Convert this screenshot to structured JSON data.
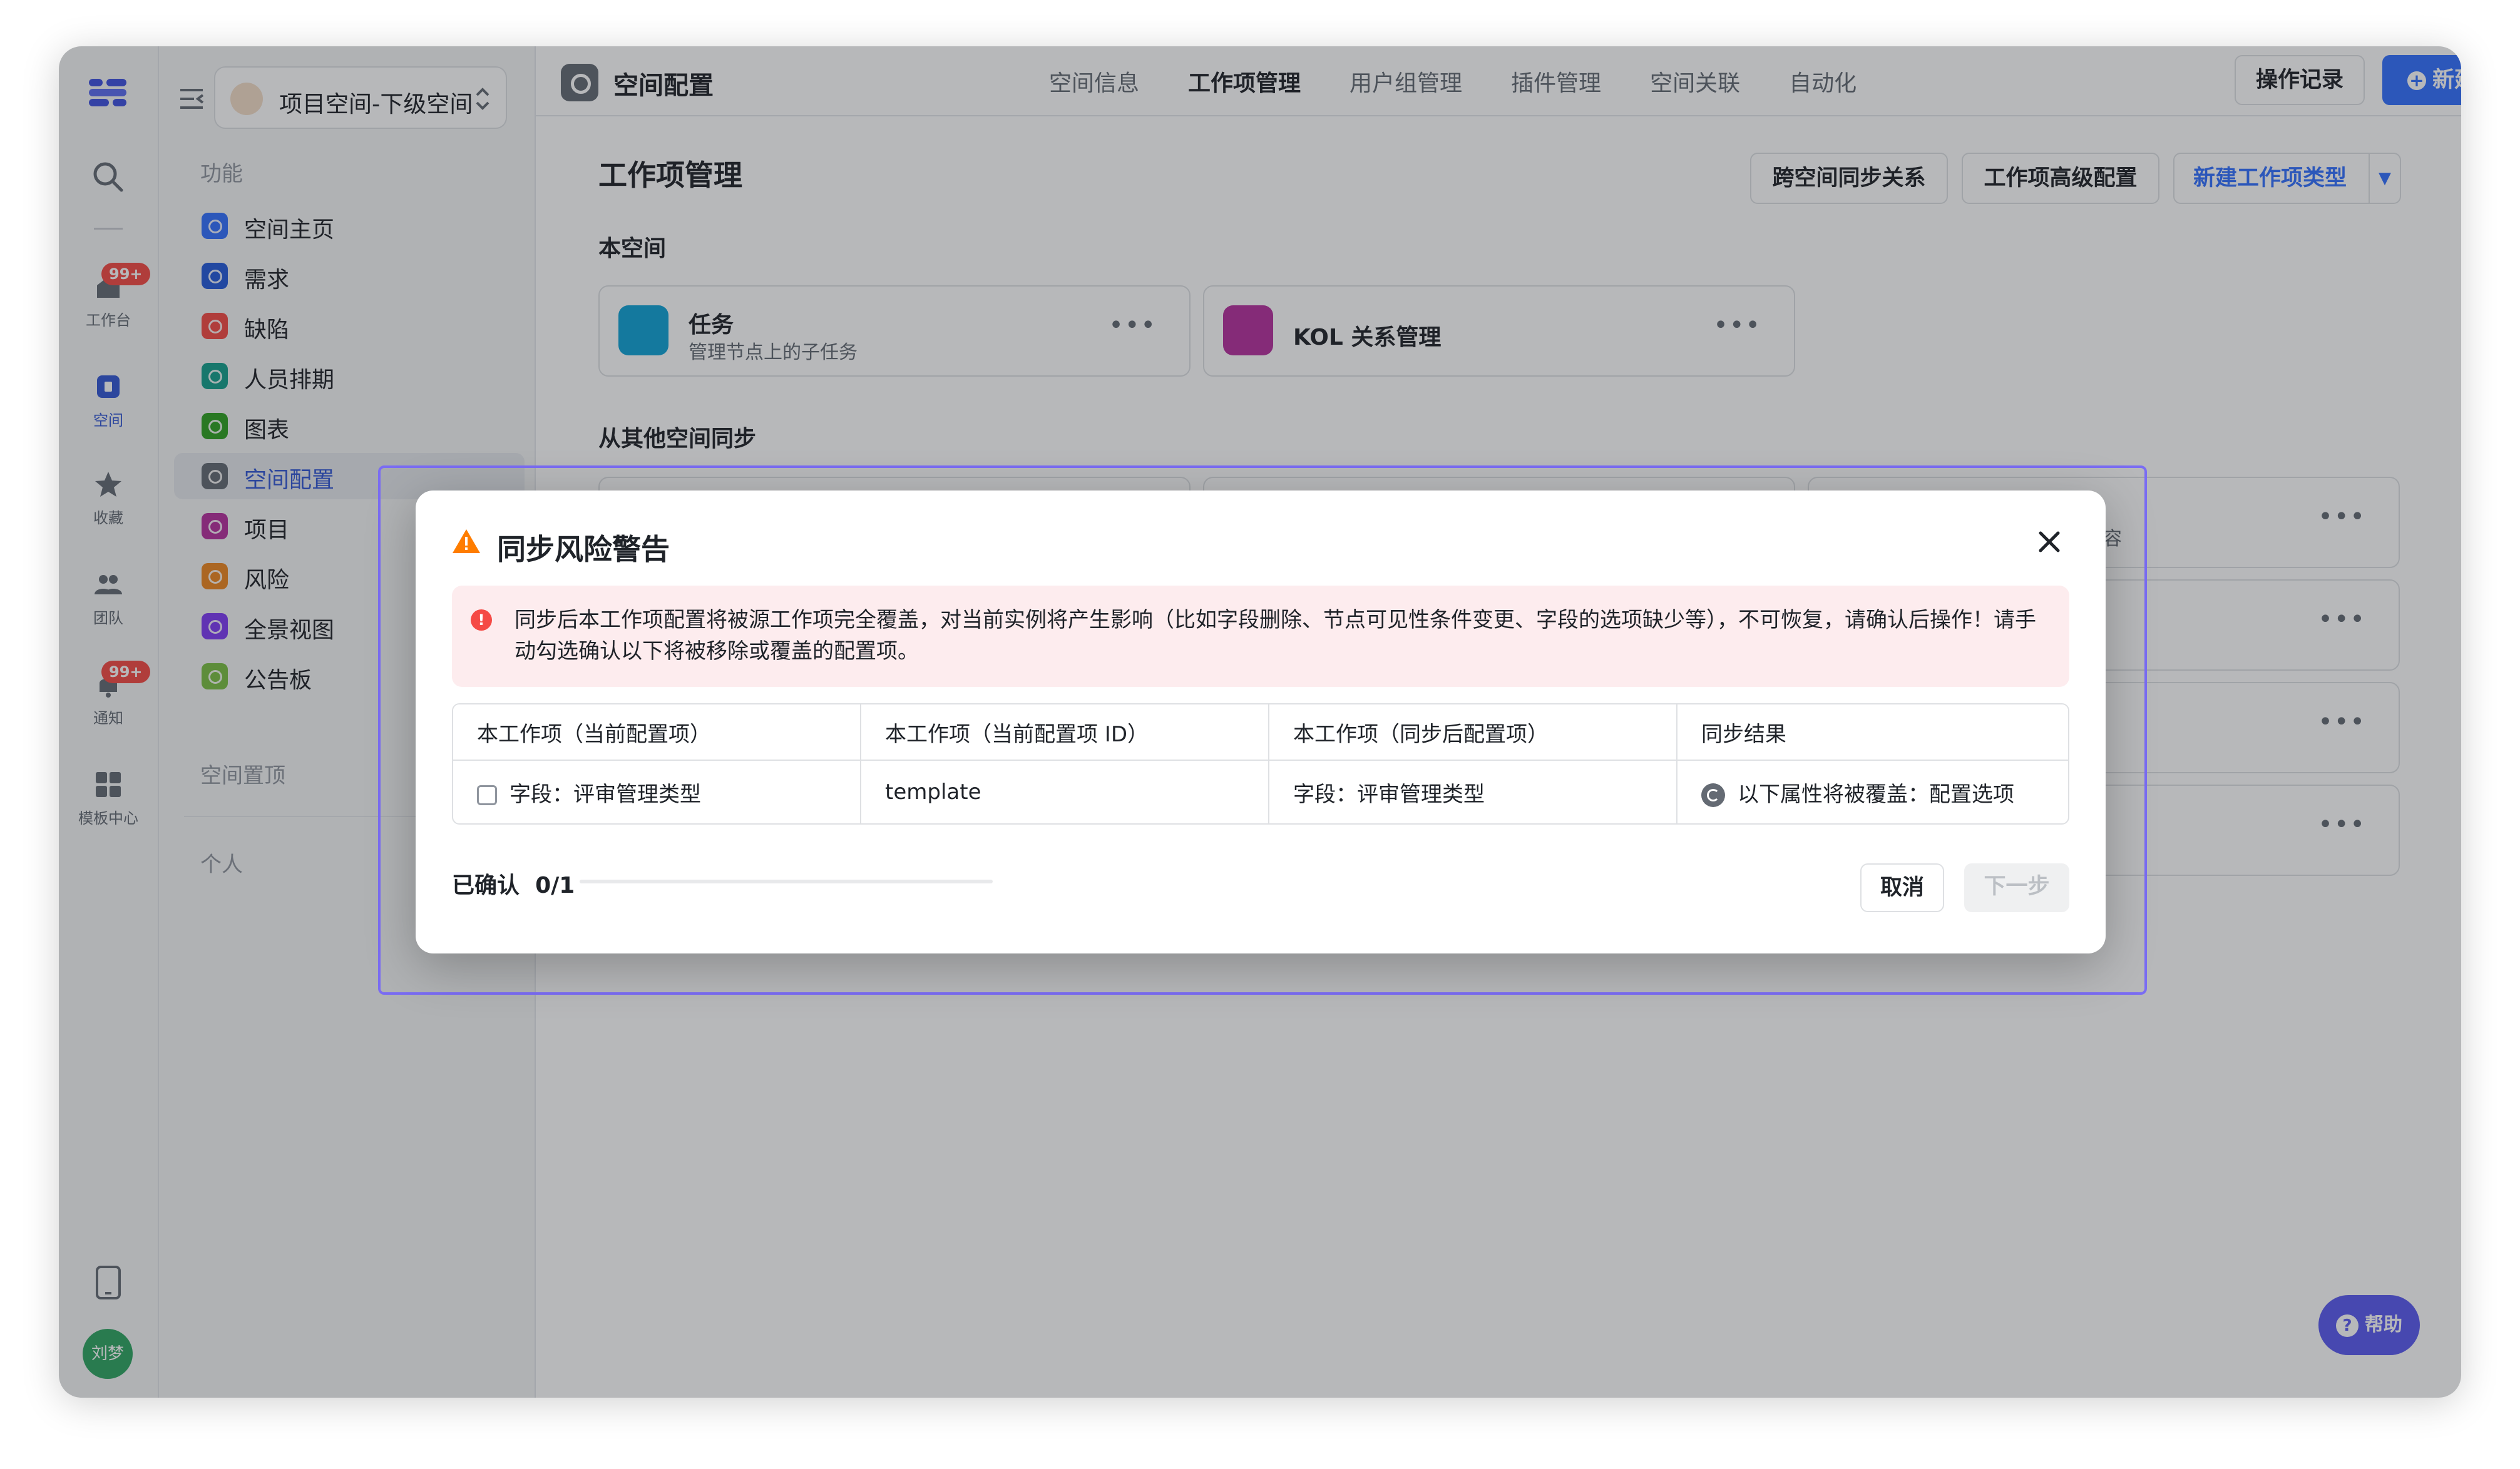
{
  "rail": {
    "items": [
      {
        "label": "工作台",
        "badge": "99+"
      },
      {
        "label": "空间"
      },
      {
        "label": "收藏"
      },
      {
        "label": "团队"
      },
      {
        "label": "通知",
        "badge": "99+"
      },
      {
        "label": "模板中心"
      }
    ],
    "avatar": "刘梦"
  },
  "sidebar": {
    "space_name": "项目空间-下级空间",
    "section_functions": "功能",
    "items": [
      {
        "label": "空间主页",
        "color": "#3370ff"
      },
      {
        "label": "需求",
        "color": "#245bdb"
      },
      {
        "label": "缺陷",
        "color": "#f54a45"
      },
      {
        "label": "人员排期",
        "color": "#14a08c"
      },
      {
        "label": "图表",
        "color": "#2ea121"
      },
      {
        "label": "空间配置",
        "color": "#646a73",
        "active": true
      },
      {
        "label": "项目",
        "color": "#b6309e"
      },
      {
        "label": "风险",
        "color": "#ed8720"
      },
      {
        "label": "全景视图",
        "color": "#7f3bf5"
      },
      {
        "label": "公告板",
        "color": "#7bc043"
      }
    ],
    "section_pinned": "空间置顶",
    "section_personal": "个人"
  },
  "topbar": {
    "title": "空间配置",
    "tabs": [
      "空间信息",
      "工作项管理",
      "用户组管理",
      "插件管理",
      "空间关联",
      "自动化"
    ],
    "active_tab": "工作项管理",
    "history_button": "操作记录",
    "new_button": "新建"
  },
  "content": {
    "heading": "工作项管理",
    "btn_cross_sync": "跨空间同步关系",
    "btn_advanced": "工作项高级配置",
    "btn_new_type": "新建工作项类型",
    "section_this_space": "本空间",
    "cards": [
      {
        "title": "任务",
        "subtitle": "管理节点上的子任务",
        "color": "#0fa2d6"
      },
      {
        "title": "KOL 关系管理",
        "subtitle": "",
        "color": "#b6309e"
      }
    ],
    "section_synced": "从其他空间同步",
    "partial_text": "容"
  },
  "help_button": "帮助",
  "modal": {
    "title": "同步风险警告",
    "alert": "同步后本工作项配置将被源工作项完全覆盖，对当前实例将产生影响（比如字段删除、节点可见性条件变更、字段的选项缺少等），不可恢复，请确认后操作！请手动勾选确认以下将被移除或覆盖的配置项。",
    "columns": [
      "本工作项（当前配置项）",
      "本工作项（当前配置项 ID）",
      "本工作项（同步后配置项）",
      "同步结果"
    ],
    "rows": [
      {
        "current": "字段：评审管理类型",
        "id": "template",
        "after": "字段：评审管理类型",
        "result": "以下属性将被覆盖：配置选项"
      }
    ],
    "confirmed_label": "已确认",
    "confirmed_count": "0/1",
    "progress": 0,
    "cancel": "取消",
    "next": "下一步"
  }
}
